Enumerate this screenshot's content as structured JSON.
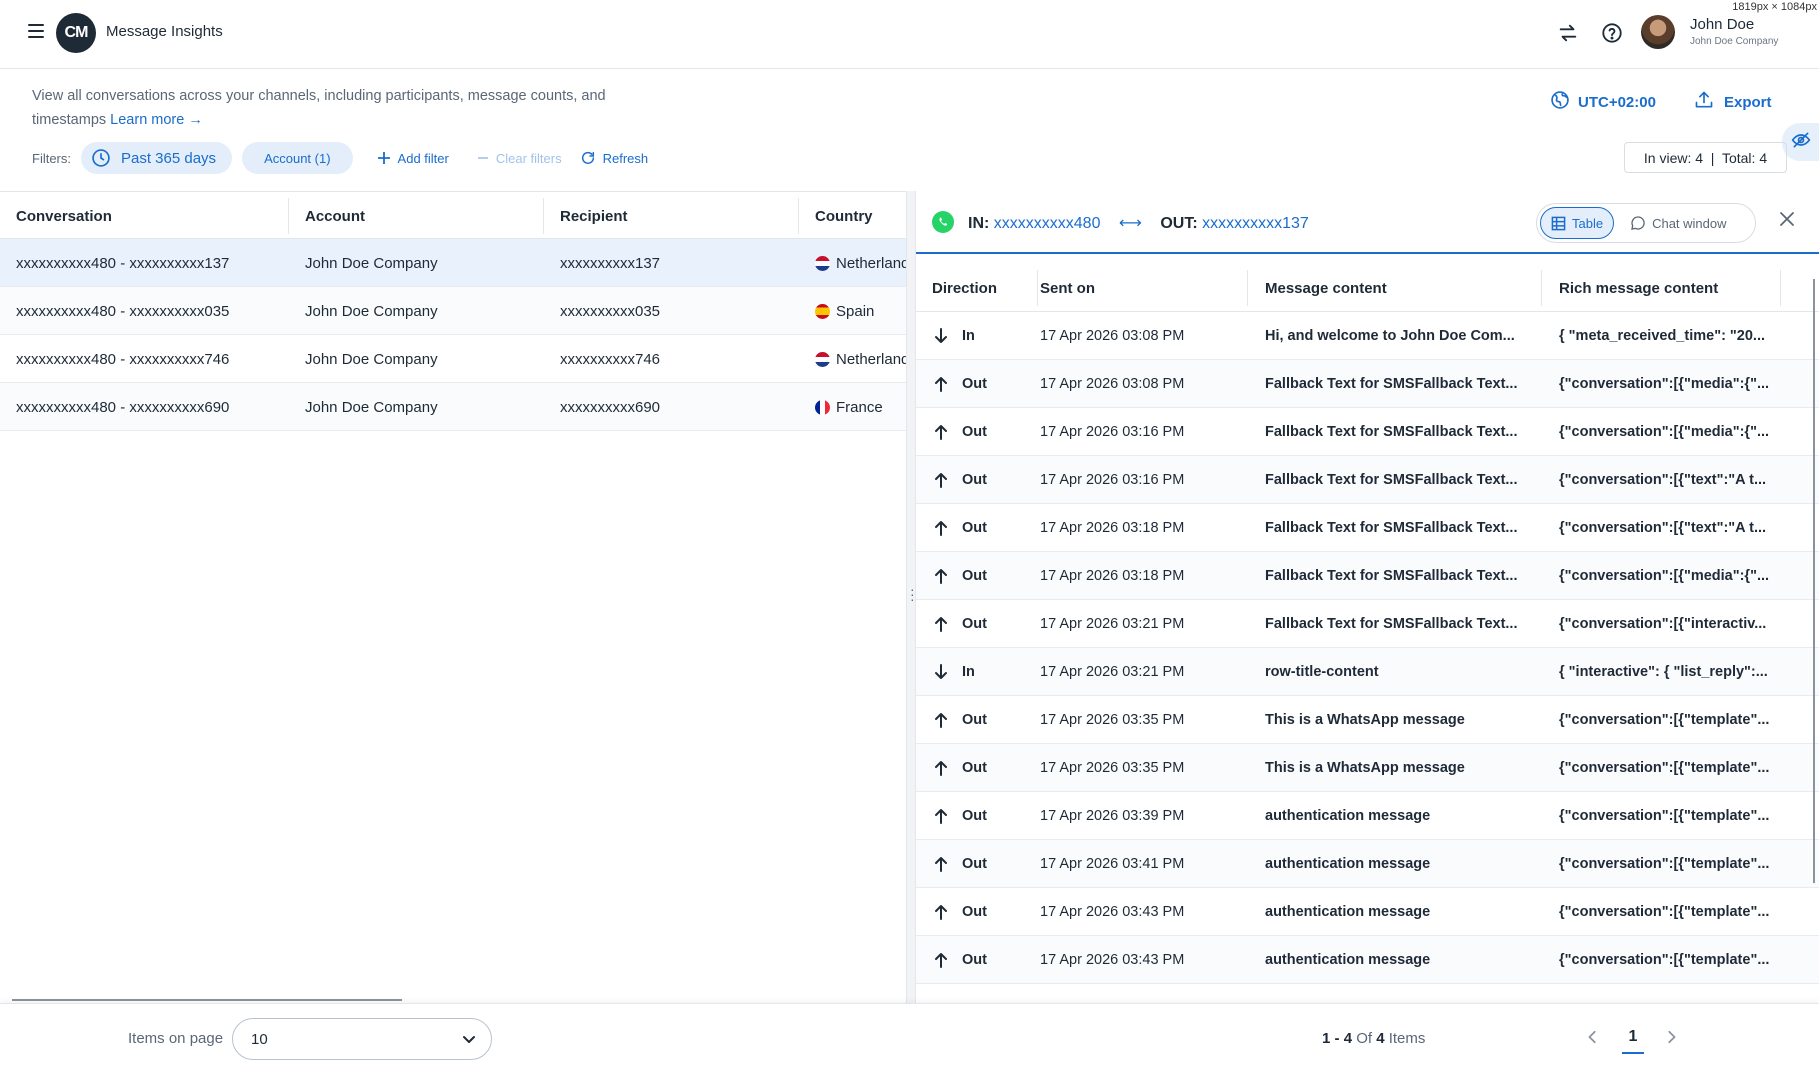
{
  "app": {
    "title": "Message Insights",
    "logo_text": "CM"
  },
  "user": {
    "name": "John Doe",
    "company": "John Doe Company"
  },
  "screen_label": "1819px × 1084px",
  "header": {
    "description": "View all conversations across your channels, including participants, message counts, and timestamps",
    "learn_more": "Learn more →",
    "timezone": "UTC+02:00",
    "export": "Export"
  },
  "filters": {
    "label": "Filters:",
    "date_chip": "Past 365 days",
    "account_chip": "Account (1)",
    "add_filter": "Add filter",
    "clear_filters": "Clear filters",
    "refresh": "Refresh",
    "in_view": "In view: 4  |  Total: 4"
  },
  "conversations": {
    "columns": [
      "Conversation",
      "Account",
      "Recipient",
      "Country"
    ],
    "rows": [
      {
        "conversation": "xxxxxxxxxx480 - xxxxxxxxxx137",
        "account": "John Doe Company",
        "recipient": "xxxxxxxxxx137",
        "country": "Netherlands",
        "flag": "nl"
      },
      {
        "conversation": "xxxxxxxxxx480 - xxxxxxxxxx035",
        "account": "John Doe Company",
        "recipient": "xxxxxxxxxx035",
        "country": "Spain",
        "flag": "es"
      },
      {
        "conversation": "xxxxxxxxxx480 - xxxxxxxxxx746",
        "account": "John Doe Company",
        "recipient": "xxxxxxxxxx746",
        "country": "Netherlands",
        "flag": "nl"
      },
      {
        "conversation": "xxxxxxxxxx480 - xxxxxxxxxx690",
        "account": "John Doe Company",
        "recipient": "xxxxxxxxxx690",
        "country": "France",
        "flag": "fr"
      }
    ]
  },
  "detail": {
    "in_label": "IN:",
    "in_number": "xxxxxxxxxx480",
    "arrow": "⟷",
    "out_label": "OUT:",
    "out_number": "xxxxxxxxxx137",
    "view_table": "Table",
    "view_chat": "Chat window",
    "columns": [
      "Direction",
      "Sent on",
      "Message content",
      "Rich message content"
    ],
    "rows": [
      {
        "direction": "In",
        "sent_on": "17 Apr 2026 03:08 PM",
        "message": "Hi, and welcome to John Doe Com...",
        "rich": "{ \"meta_received_time\": \"20..."
      },
      {
        "direction": "Out",
        "sent_on": "17 Apr 2026 03:08 PM",
        "message": "Fallback Text for SMSFallback Text...",
        "rich": "{\"conversation\":[{\"media\":{\"..."
      },
      {
        "direction": "Out",
        "sent_on": "17 Apr 2026 03:16 PM",
        "message": "Fallback Text for SMSFallback Text...",
        "rich": "{\"conversation\":[{\"media\":{\"..."
      },
      {
        "direction": "Out",
        "sent_on": "17 Apr 2026 03:16 PM",
        "message": "Fallback Text for SMSFallback Text...",
        "rich": "{\"conversation\":[{\"text\":\"A t..."
      },
      {
        "direction": "Out",
        "sent_on": "17 Apr 2026 03:18 PM",
        "message": "Fallback Text for SMSFallback Text...",
        "rich": "{\"conversation\":[{\"text\":\"A t..."
      },
      {
        "direction": "Out",
        "sent_on": "17 Apr 2026 03:18 PM",
        "message": "Fallback Text for SMSFallback Text...",
        "rich": "{\"conversation\":[{\"media\":{\"..."
      },
      {
        "direction": "Out",
        "sent_on": "17 Apr 2026 03:21 PM",
        "message": "Fallback Text for SMSFallback Text...",
        "rich": "{\"conversation\":[{\"interactiv..."
      },
      {
        "direction": "In",
        "sent_on": "17 Apr 2026 03:21 PM",
        "message": "row-title-content",
        "rich": "{ \"interactive\": { \"list_reply\":..."
      },
      {
        "direction": "Out",
        "sent_on": "17 Apr 2026 03:35 PM",
        "message": "This is a WhatsApp message",
        "rich": "{\"conversation\":[{\"template\"..."
      },
      {
        "direction": "Out",
        "sent_on": "17 Apr 2026 03:35 PM",
        "message": "This is a WhatsApp message",
        "rich": "{\"conversation\":[{\"template\"..."
      },
      {
        "direction": "Out",
        "sent_on": "17 Apr 2026 03:39 PM",
        "message": "authentication message",
        "rich": "{\"conversation\":[{\"template\"..."
      },
      {
        "direction": "Out",
        "sent_on": "17 Apr 2026 03:41 PM",
        "message": "authentication message",
        "rich": "{\"conversation\":[{\"template\"..."
      },
      {
        "direction": "Out",
        "sent_on": "17 Apr 2026 03:43 PM",
        "message": "authentication message",
        "rich": "{\"conversation\":[{\"template\"..."
      },
      {
        "direction": "Out",
        "sent_on": "17 Apr 2026 03:43 PM",
        "message": "authentication message",
        "rich": "{\"conversation\":[{\"template\"..."
      }
    ]
  },
  "footer": {
    "items_on_page_label": "Items on page",
    "items_on_page_value": "10",
    "range_start": "1",
    "range_sep": " - ",
    "range_end": "4",
    "range_of": " Of ",
    "range_total": "4",
    "range_suffix": " Items",
    "current_page": "1"
  },
  "colors": {
    "accent": "#1a6dcc",
    "selected_row": "#e8f1fc",
    "whatsapp": "#25d366"
  },
  "icons": {
    "menu": "hamburger-icon",
    "swap": "swap-arrows-icon",
    "help": "help-circle-icon",
    "apps": "grid-apps-icon",
    "globe": "globe-icon",
    "export": "upload-icon",
    "hide": "eye-off-icon",
    "clock": "clock-icon",
    "plus": "plus-icon",
    "minus": "minus-icon",
    "refresh": "refresh-icon",
    "whatsapp": "whatsapp-icon",
    "table": "table-icon",
    "chat": "chat-bubble-icon",
    "close": "close-icon",
    "arrow_up": "arrow-up-icon",
    "arrow_down": "arrow-down-icon",
    "chevron_down": "chevron-down-icon",
    "chevron_left": "chevron-left-icon",
    "chevron_right": "chevron-right-icon"
  }
}
